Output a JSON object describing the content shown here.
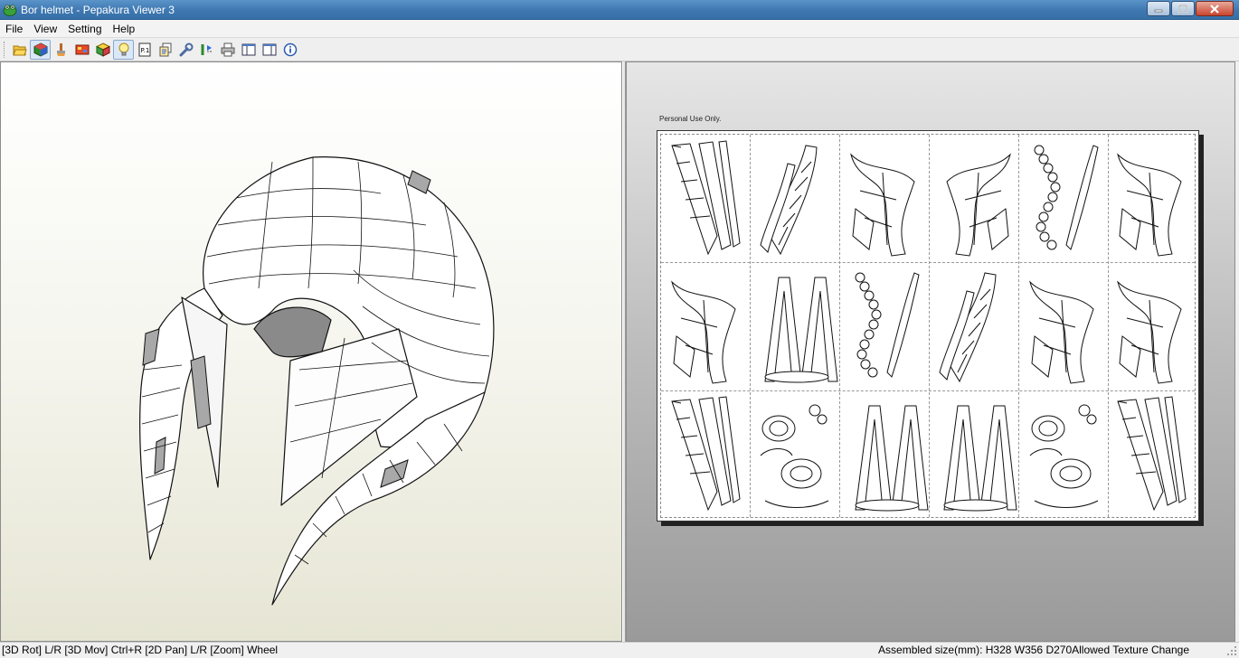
{
  "window": {
    "title": "Bor helmet - Pepakura Viewer 3",
    "app_icon": "pepakura-frog-icon",
    "controls": [
      "minimize-icon",
      "maximize-icon",
      "close-icon"
    ]
  },
  "menu": {
    "items": [
      "File",
      "View",
      "Setting",
      "Help"
    ]
  },
  "toolbar": {
    "buttons": [
      {
        "icon": "open-folder-icon",
        "active": false
      },
      {
        "icon": "3d-view-icon",
        "active": true
      },
      {
        "icon": "paint-brush-icon",
        "active": false
      },
      {
        "icon": "texture-icon",
        "active": false
      },
      {
        "icon": "cube-icon",
        "active": false
      },
      {
        "icon": "light-bulb-icon",
        "active": true
      },
      {
        "icon": "page-number-icon",
        "active": false
      },
      {
        "icon": "multi-page-icon",
        "active": false
      },
      {
        "icon": "wrench-icon",
        "active": false
      },
      {
        "icon": "fold-lines-icon",
        "active": false
      },
      {
        "icon": "print-icon",
        "active": false
      },
      {
        "icon": "window-layout-icon",
        "active": false
      },
      {
        "icon": "window-split-icon",
        "active": false
      },
      {
        "icon": "info-icon",
        "active": false
      }
    ]
  },
  "viewer_2d": {
    "watermark": "Personal Use Only."
  },
  "status": {
    "left": "[3D Rot] L/R [3D Mov] Ctrl+R [2D Pan] L/R [Zoom] Wheel",
    "right": "Assembled size(mm): H328 W356 D270Allowed Texture Change"
  },
  "colors": {
    "titlebar": "#3f78b1",
    "viewer_3d_bg": "#f5f5ee",
    "viewer_2d_bg": "#bcbcbc"
  }
}
